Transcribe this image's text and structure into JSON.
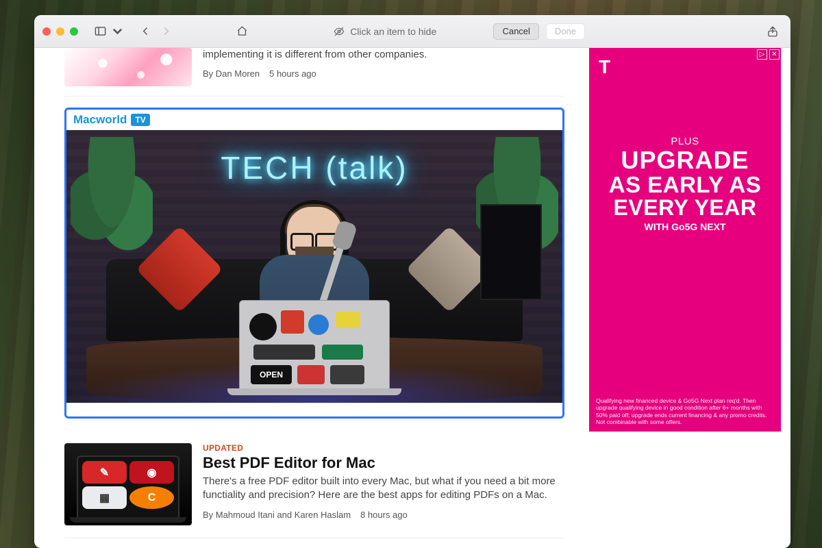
{
  "toolbar": {
    "hint_text": "Click an item to hide",
    "cancel_label": "Cancel",
    "done_label": "Done"
  },
  "feed": {
    "partial_article": {
      "dek_line": "implementing it is different from other companies.",
      "byline_prefix": "By ",
      "author": "Dan Moren",
      "timestamp": "5 hours ago"
    },
    "video_block": {
      "brand_word": "Macworld",
      "brand_badge": "TV",
      "neon_text": "TECH (talk)"
    },
    "article2": {
      "tag": "UPDATED",
      "headline": "Best PDF Editor for Mac",
      "dek": "There's a free PDF editor built into every Mac, but what if you need a bit more functiality and precision? Here are the best apps for editing PDFs on a Mac.",
      "byline_prefix": "By ",
      "authors": "Mahmoud Itani and Karen Haslam",
      "timestamp": "8 hours ago"
    }
  },
  "ad": {
    "adchoices": "▷",
    "close": "✕",
    "logo": "T",
    "plus": "PLUS",
    "line1": "UPGRADE",
    "line2": "AS EARLY AS",
    "line3": "EVERY YEAR",
    "sub": "WITH Go5G NEXT",
    "fine": "Qualifying new financed device & Go5G Next plan req'd. Then upgrade qualifying device in good condition after 6+ months with 50% paid off; upgrade ends current financing & any promo credits. Not combinable with some offers."
  }
}
